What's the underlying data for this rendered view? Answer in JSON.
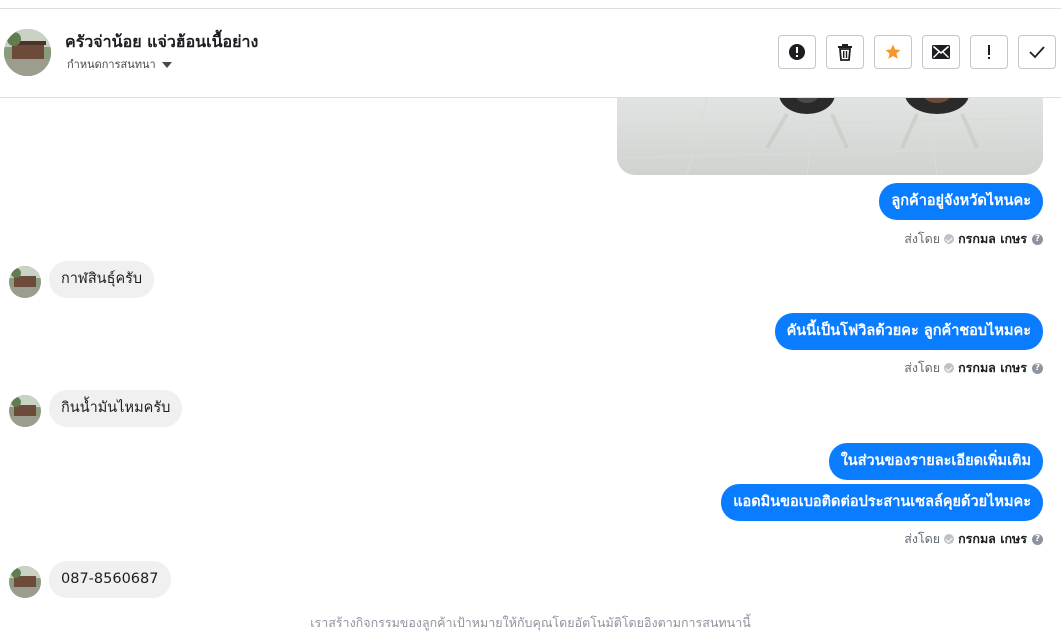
{
  "header": {
    "page_name": "ครัวจ่าน้อย แจ่วฮ้อนเนื้อย่าง",
    "assign_label": "กำหนดการสนทนา",
    "actions": [
      "report-icon",
      "trash-icon",
      "star-icon",
      "mail-icon",
      "exclamation-icon",
      "check-icon"
    ]
  },
  "colors": {
    "outgoing": "#0a7cff",
    "incoming": "#f0f0f0",
    "star": "#f5962a"
  },
  "sent_by": {
    "prefix": "ส่งโดย",
    "name": "กรกมล เกษร",
    "help": "?"
  },
  "messages": [
    {
      "dir": "out",
      "text": "ลูกค้าอยู่จังหวัดไหนคะ"
    },
    {
      "dir": "in",
      "text": "กาฬสินธุ์ครับ"
    },
    {
      "dir": "out",
      "text": "คันนี้เป็นโฟวิลด้วยคะ ลูกค้าชอบไหมคะ"
    },
    {
      "dir": "in",
      "text": "กินน้ำมันไหมครับ"
    },
    {
      "dir": "out",
      "text": "ในส่วนของรายละเอียดเพิ่มเติม"
    },
    {
      "dir": "out",
      "text": "แอดมินขอเบอติดต่อประสานเซลล์คุยด้วยไหมคะ"
    },
    {
      "dir": "in",
      "text": "087-8560687"
    }
  ],
  "footer_note": "เราสร้างกิจกรรมของลูกค้าเป้าหมายให้กับคุณโดยอัตโนมัติโดยอิงตามการสนทนานี้"
}
